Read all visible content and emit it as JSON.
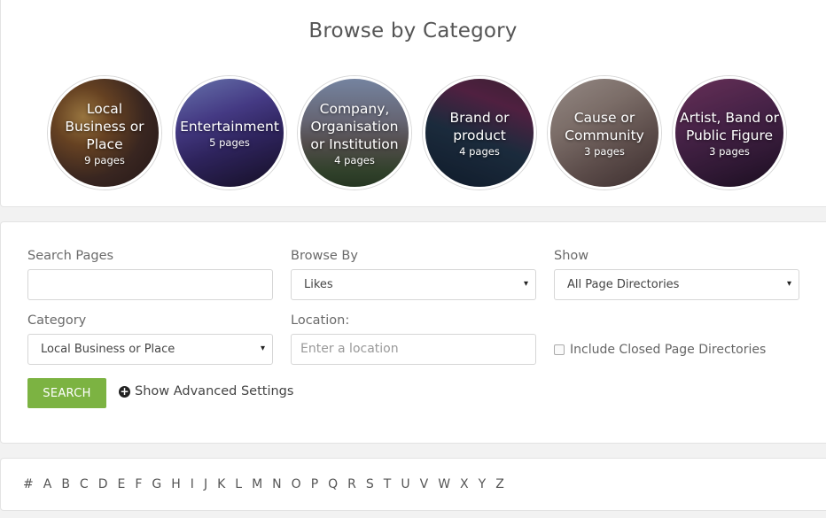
{
  "browse_title": "Browse by Category",
  "categories": [
    {
      "name": "Local Business or Place",
      "count": "9 pages"
    },
    {
      "name": "Entertainment",
      "count": "5 pages"
    },
    {
      "name": "Company, Organisation or Institution",
      "count": "4 pages"
    },
    {
      "name": "Brand or product",
      "count": "4 pages"
    },
    {
      "name": "Cause or Community",
      "count": "3 pages"
    },
    {
      "name": "Artist, Band or Public Figure",
      "count": "3 pages"
    }
  ],
  "search_form": {
    "search_label": "Search Pages",
    "search_value": "",
    "browse_label": "Browse By",
    "browse_value": "Likes",
    "show_label": "Show",
    "show_value": "All Page Directories",
    "category_label": "Category",
    "category_value": "Local Business or Place",
    "location_label": "Location:",
    "location_placeholder": "Enter a location",
    "closed_label": "Include Closed Page Directories",
    "closed_checked": false,
    "search_button": "SEARCH",
    "advanced_label": "Show Advanced Settings",
    "dropdown_arrow": "▾",
    "plus_glyph": "+"
  },
  "alphabet": [
    "#",
    "A",
    "B",
    "C",
    "D",
    "E",
    "F",
    "G",
    "H",
    "I",
    "J",
    "K",
    "L",
    "M",
    "N",
    "O",
    "P",
    "Q",
    "R",
    "S",
    "T",
    "U",
    "V",
    "W",
    "X",
    "Y",
    "Z"
  ],
  "colors": {
    "accent": "#7cb342",
    "page_bg": "#f2f2f2",
    "panel_bg": "#ffffff"
  }
}
